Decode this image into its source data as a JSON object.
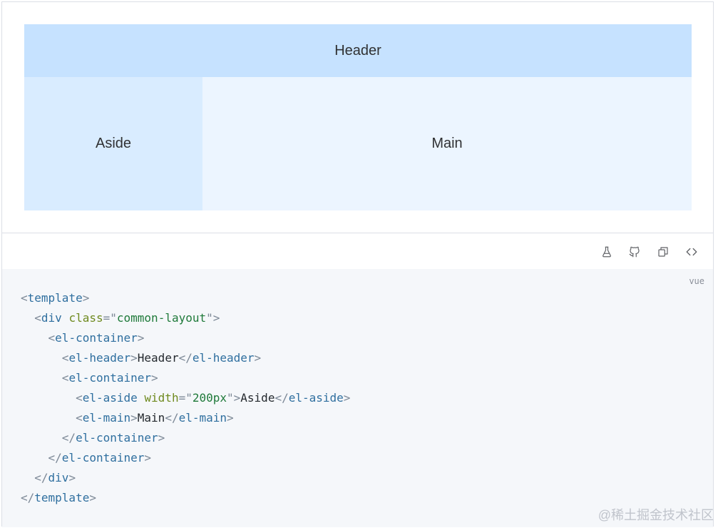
{
  "preview": {
    "header_label": "Header",
    "aside_label": "Aside",
    "main_label": "Main"
  },
  "toolbar": {
    "icons": [
      "playground-flask-icon",
      "github-icon",
      "copy-icon",
      "view-source-icon"
    ]
  },
  "code": {
    "language": "vue",
    "lines": [
      [
        {
          "t": "punc",
          "v": "<"
        },
        {
          "t": "tag",
          "v": "template"
        },
        {
          "t": "punc",
          "v": ">"
        }
      ],
      [
        {
          "t": "text",
          "v": "  "
        },
        {
          "t": "punc",
          "v": "<"
        },
        {
          "t": "tag",
          "v": "div"
        },
        {
          "t": "text",
          "v": " "
        },
        {
          "t": "attr",
          "v": "class"
        },
        {
          "t": "punc",
          "v": "=\""
        },
        {
          "t": "str",
          "v": "common-layout"
        },
        {
          "t": "punc",
          "v": "\">"
        }
      ],
      [
        {
          "t": "text",
          "v": "    "
        },
        {
          "t": "punc",
          "v": "<"
        },
        {
          "t": "tag",
          "v": "el-container"
        },
        {
          "t": "punc",
          "v": ">"
        }
      ],
      [
        {
          "t": "text",
          "v": "      "
        },
        {
          "t": "punc",
          "v": "<"
        },
        {
          "t": "tag",
          "v": "el-header"
        },
        {
          "t": "punc",
          "v": ">"
        },
        {
          "t": "text",
          "v": "Header"
        },
        {
          "t": "punc",
          "v": "</"
        },
        {
          "t": "tag",
          "v": "el-header"
        },
        {
          "t": "punc",
          "v": ">"
        }
      ],
      [
        {
          "t": "text",
          "v": "      "
        },
        {
          "t": "punc",
          "v": "<"
        },
        {
          "t": "tag",
          "v": "el-container"
        },
        {
          "t": "punc",
          "v": ">"
        }
      ],
      [
        {
          "t": "text",
          "v": "        "
        },
        {
          "t": "punc",
          "v": "<"
        },
        {
          "t": "tag",
          "v": "el-aside"
        },
        {
          "t": "text",
          "v": " "
        },
        {
          "t": "attr",
          "v": "width"
        },
        {
          "t": "punc",
          "v": "=\""
        },
        {
          "t": "str",
          "v": "200px"
        },
        {
          "t": "punc",
          "v": "\">"
        },
        {
          "t": "text",
          "v": "Aside"
        },
        {
          "t": "punc",
          "v": "</"
        },
        {
          "t": "tag",
          "v": "el-aside"
        },
        {
          "t": "punc",
          "v": ">"
        }
      ],
      [
        {
          "t": "text",
          "v": "        "
        },
        {
          "t": "punc",
          "v": "<"
        },
        {
          "t": "tag",
          "v": "el-main"
        },
        {
          "t": "punc",
          "v": ">"
        },
        {
          "t": "text",
          "v": "Main"
        },
        {
          "t": "punc",
          "v": "</"
        },
        {
          "t": "tag",
          "v": "el-main"
        },
        {
          "t": "punc",
          "v": ">"
        }
      ],
      [
        {
          "t": "text",
          "v": "      "
        },
        {
          "t": "punc",
          "v": "</"
        },
        {
          "t": "tag",
          "v": "el-container"
        },
        {
          "t": "punc",
          "v": ">"
        }
      ],
      [
        {
          "t": "text",
          "v": "    "
        },
        {
          "t": "punc",
          "v": "</"
        },
        {
          "t": "tag",
          "v": "el-container"
        },
        {
          "t": "punc",
          "v": ">"
        }
      ],
      [
        {
          "t": "text",
          "v": "  "
        },
        {
          "t": "punc",
          "v": "</"
        },
        {
          "t": "tag",
          "v": "div"
        },
        {
          "t": "punc",
          "v": ">"
        }
      ],
      [
        {
          "t": "punc",
          "v": "</"
        },
        {
          "t": "tag",
          "v": "template"
        },
        {
          "t": "punc",
          "v": ">"
        }
      ]
    ]
  },
  "watermark": "@稀土掘金技术社区",
  "colors": {
    "header_bg": "#c6e2ff",
    "aside_bg": "#d9ecff",
    "main_bg": "#ecf5ff",
    "code_bg": "#f5f7fa"
  }
}
